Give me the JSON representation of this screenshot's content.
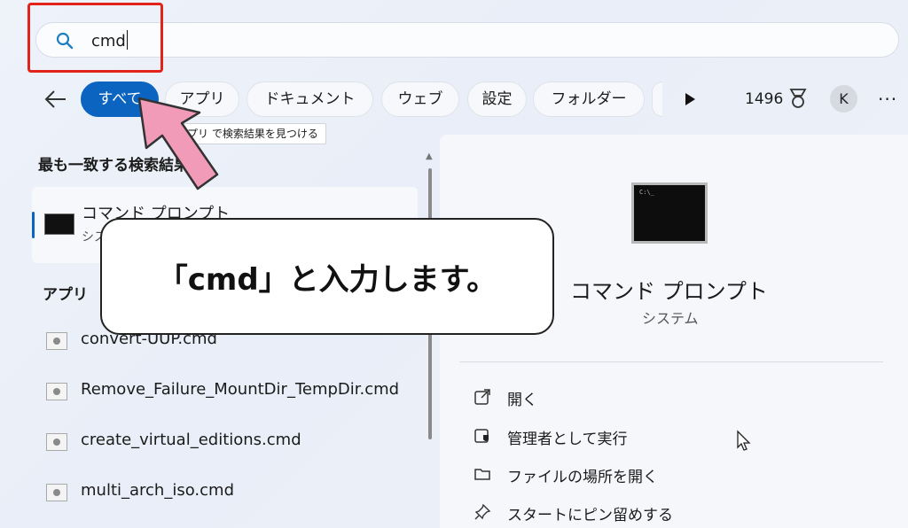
{
  "search": {
    "value": "cmd"
  },
  "filters": {
    "chips": [
      "すべて",
      "アプリ",
      "ドキュメント",
      "ウェブ",
      "設定",
      "フォルダー"
    ],
    "points": "1496",
    "avatar": "K",
    "more": "···"
  },
  "tooltip": "アプリ で検索結果を見つける",
  "left": {
    "best_match_title": "最も一致する検索結果",
    "best": {
      "name": "コマンド プロンプト",
      "sub": "システム"
    },
    "apps_title": "アプリ",
    "apps": [
      "convert-UUP.cmd",
      "Remove_Failure_MountDir_TempDir.cmd",
      "create_virtual_editions.cmd",
      "multi_arch_iso.cmd"
    ]
  },
  "right": {
    "title": "コマンド プロンプト",
    "sub": "システム",
    "actions": [
      "開く",
      "管理者として実行",
      "ファイルの場所を開く",
      "スタートにピン留めする"
    ]
  },
  "callout": "「cmd」と入力します。",
  "colors": {
    "accent": "#0b64c0",
    "highlight_box": "#e2231a",
    "arrow": "#f29bb8"
  }
}
